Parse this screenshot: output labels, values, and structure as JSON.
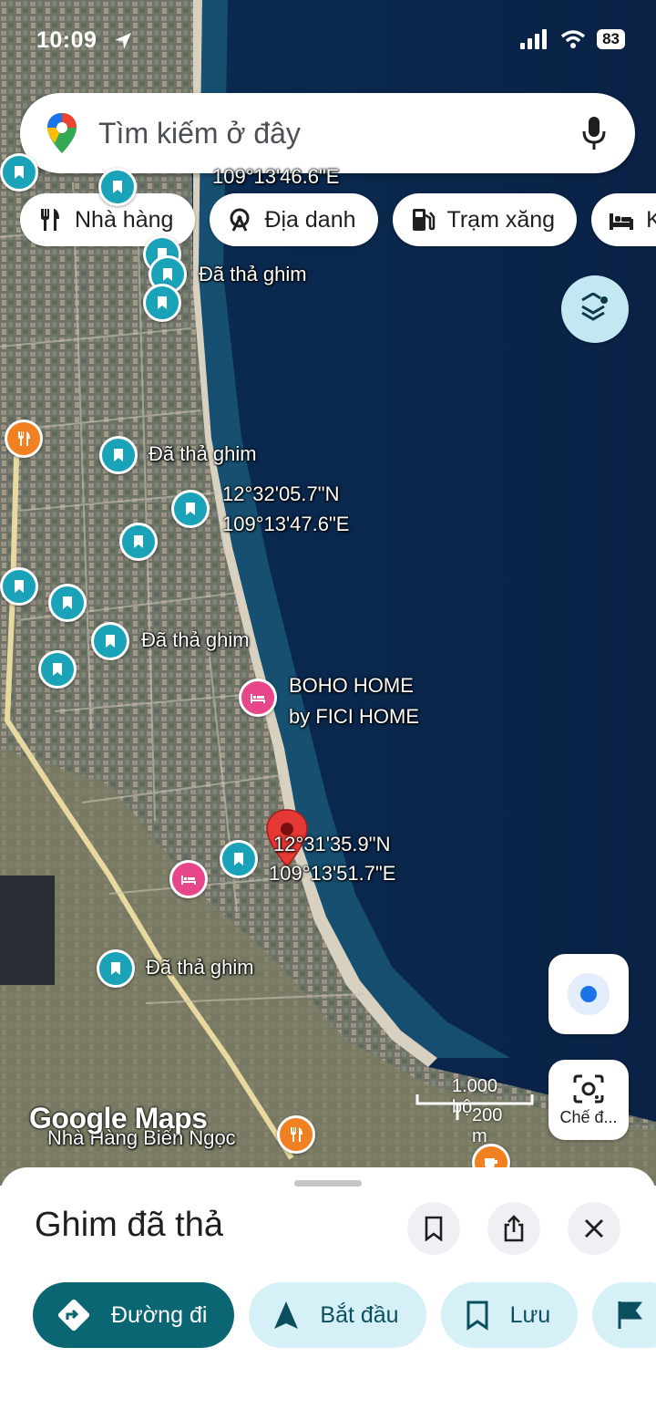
{
  "status_bar": {
    "time": "10:09",
    "battery": "83"
  },
  "search": {
    "placeholder": "Tìm kiếm ở đây"
  },
  "chips": [
    {
      "label": "Nhà hàng",
      "icon": "fork-knife-icon"
    },
    {
      "label": "Địa danh",
      "icon": "ferris-wheel-icon"
    },
    {
      "label": "Trạm xăng",
      "icon": "gas-pump-icon"
    },
    {
      "label": "K",
      "icon": "bed-icon"
    }
  ],
  "map": {
    "labels": {
      "top_coord": "109°13'46.6\"E",
      "pin1": "Đã thả ghim",
      "pin2": "Đã thả ghim",
      "coord2_lat": "12°32'05.7\"N",
      "coord2_lon": "109°13'47.6\"E",
      "pin3": "Đã thả ghim",
      "hotel_line1": "BOHO HOME",
      "hotel_line2": "by FICI HOME",
      "red_lat": "12°31'35.9\"N",
      "red_lon": "109°13'51.7\"E",
      "pin4": "Đã thả ghim",
      "restaurant": "Nhà Hàng Biển Ngọc"
    },
    "scale_feet": "1.000 bộ",
    "scale_meters": "200 m",
    "logo": "Google Maps",
    "lens_label": "Chế đ..."
  },
  "sheet": {
    "title": "Ghim đã thả",
    "actions": [
      {
        "label": "Đường đi",
        "icon": "directions-icon"
      },
      {
        "label": "Bắt đầu",
        "icon": "navigation-arrow-icon"
      },
      {
        "label": "Lưu",
        "icon": "bookmark-icon"
      }
    ]
  },
  "colors": {
    "teal_pin": "#1aa3b8",
    "primary": "#0b6673",
    "tonal": "#d6f0f8",
    "red_pin": "#e53935"
  }
}
